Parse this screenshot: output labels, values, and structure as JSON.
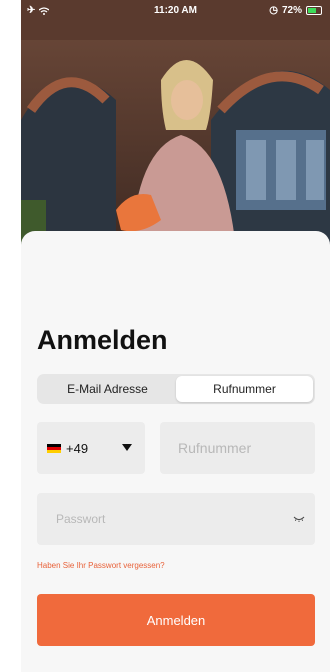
{
  "status_bar": {
    "time": "11:20 AM",
    "battery_percent": "72%"
  },
  "login": {
    "title": "Anmelden",
    "tabs": [
      {
        "label": "E-Mail Adresse",
        "selected": false
      },
      {
        "label": "Rufnummer",
        "selected": true
      }
    ],
    "country_code": "+49",
    "country_flag": "germany-flag-icon",
    "phone_placeholder": "Rufnummer",
    "password_placeholder": "Passwort",
    "forgot_password": "Haben Sie Ihr Passwort vergessen?",
    "submit_label": "Anmelden"
  },
  "colors": {
    "accent": "#f06a3c",
    "field_bg": "#ececec",
    "sheet_bg": "#f7f7f7"
  }
}
